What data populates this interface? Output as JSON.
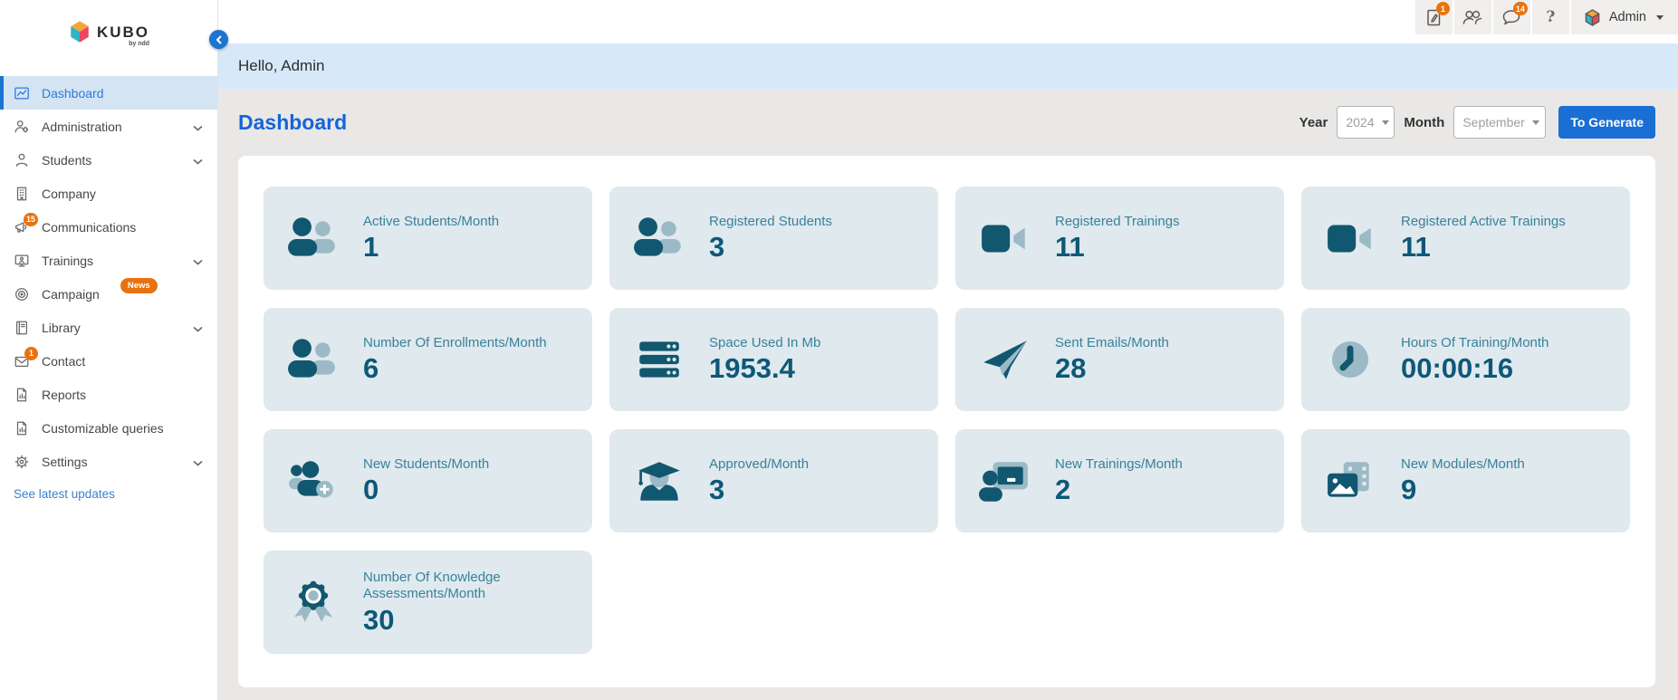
{
  "brand": {
    "logo_text": "KUBO",
    "logo_sub": "by ndd"
  },
  "header": {
    "icons": [
      {
        "name": "compose",
        "badge": "1"
      },
      {
        "name": "users"
      },
      {
        "name": "chat",
        "badge": "14"
      },
      {
        "name": "help",
        "glyph": "?"
      }
    ],
    "user_menu": {
      "label": "Admin"
    }
  },
  "greeting": "Hello, Admin",
  "page": {
    "title": "Dashboard",
    "filters": {
      "year_label": "Year",
      "year_value": "2024",
      "month_label": "Month",
      "month_value": "September",
      "generate_button": "To Generate"
    }
  },
  "sidebar": {
    "items": [
      {
        "label": "Dashboard",
        "active": true
      },
      {
        "label": "Administration",
        "expandable": true
      },
      {
        "label": "Students",
        "expandable": true
      },
      {
        "label": "Company"
      },
      {
        "label": "Communications",
        "badge": "15"
      },
      {
        "label": "Trainings",
        "expandable": true
      },
      {
        "label": "Campaign",
        "tag": "News"
      },
      {
        "label": "Library",
        "expandable": true
      },
      {
        "label": "Contact",
        "badge": "1"
      },
      {
        "label": "Reports"
      },
      {
        "label": "Customizable queries"
      },
      {
        "label": "Settings",
        "expandable": true
      }
    ],
    "footer_link": "See latest updates"
  },
  "cards": [
    {
      "label": "Active Students/Month",
      "value": "1",
      "icon": "users"
    },
    {
      "label": "Registered Students",
      "value": "3",
      "icon": "users"
    },
    {
      "label": "Registered Trainings",
      "value": "11",
      "icon": "video"
    },
    {
      "label": "Registered Active Trainings",
      "value": "11",
      "icon": "video"
    },
    {
      "label": "Number Of Enrollments/Month",
      "value": "6",
      "icon": "users"
    },
    {
      "label": "Space Used In Mb",
      "value": "1953.4",
      "icon": "server"
    },
    {
      "label": "Sent Emails/Month",
      "value": "28",
      "icon": "paper-plane"
    },
    {
      "label": "Hours Of Training/Month",
      "value": "00:00:16",
      "icon": "clock"
    },
    {
      "label": "New Students/Month",
      "value": "0",
      "icon": "user-plus"
    },
    {
      "label": "Approved/Month",
      "value": "3",
      "icon": "graduate"
    },
    {
      "label": "New Trainings/Month",
      "value": "2",
      "icon": "training-board"
    },
    {
      "label": "New Modules/Month",
      "value": "9",
      "icon": "modules"
    },
    {
      "label": "Number Of Knowledge Assessments/Month",
      "value": "30",
      "icon": "medal"
    }
  ],
  "colors": {
    "accent_blue": "#1b74d2",
    "title_blue": "#1565d8",
    "hello_bar": "#d7e9f8",
    "card_bg": "#dfe9ee",
    "icon_dark_teal": "#11576f",
    "icon_light_teal": "#9cb9c6",
    "label_teal": "#39819a",
    "value_teal": "#0e5878",
    "badge_orange": "#e8730e",
    "main_bg": "#e9e8e6"
  }
}
